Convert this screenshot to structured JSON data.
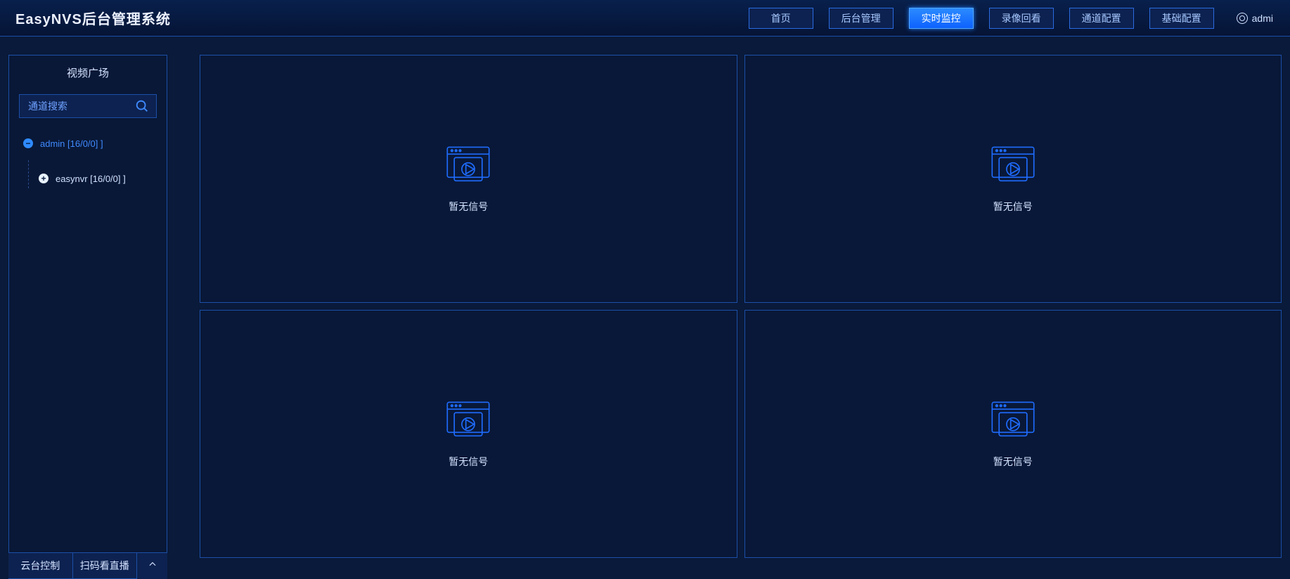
{
  "header": {
    "title": "EasyNVS后台管理系统",
    "nav": [
      {
        "id": "home",
        "label": "首页",
        "active": false
      },
      {
        "id": "backend",
        "label": "后台管理",
        "active": false
      },
      {
        "id": "live",
        "label": "实时监控",
        "active": true
      },
      {
        "id": "playback",
        "label": "录像回看",
        "active": false
      },
      {
        "id": "channel",
        "label": "通道配置",
        "active": false
      },
      {
        "id": "basic",
        "label": "基础配置",
        "active": false
      }
    ],
    "user_label": "admi"
  },
  "sidebar": {
    "panel_title": "视频广场",
    "search_placeholder": "通道搜索",
    "tree": {
      "root": {
        "label": "admin [16/0/0] ]",
        "expanded": true
      },
      "child": {
        "label": "easynvr [16/0/0] ]",
        "expanded": false
      }
    },
    "footer": {
      "tab_ptz": "云台控制",
      "tab_qr": "扫码看直播",
      "collapse_glyph": "⌃"
    }
  },
  "viewer": {
    "no_signal_text": "暂无信号",
    "tiles": [
      1,
      2,
      3,
      4
    ]
  }
}
